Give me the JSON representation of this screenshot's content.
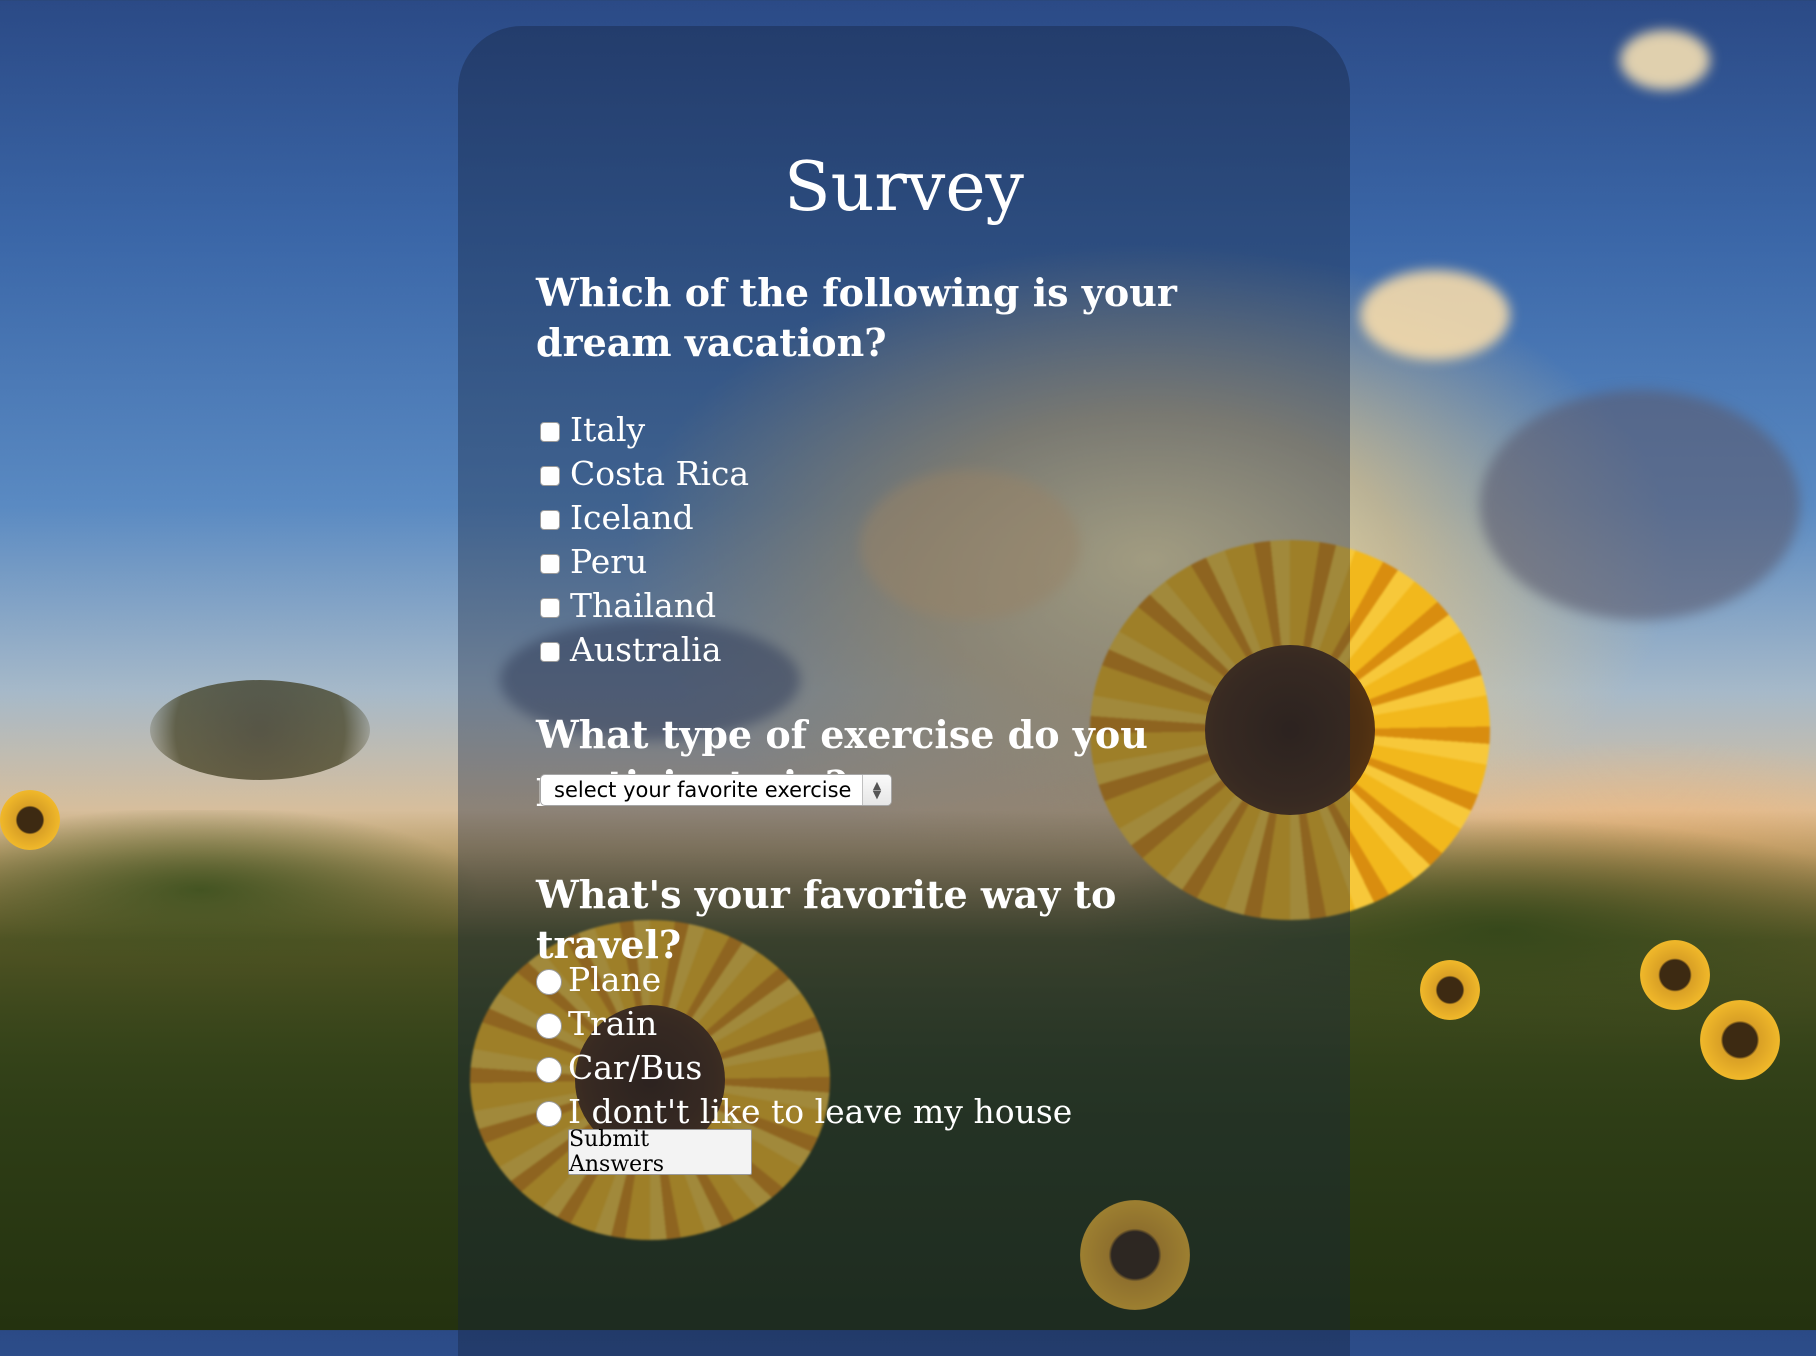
{
  "survey": {
    "title": "Survey",
    "q1": {
      "text": "Which of the following is your dream vacation?",
      "options": [
        "Italy",
        "Costa Rica",
        "Iceland",
        "Peru",
        "Thailand",
        "Australia"
      ]
    },
    "q2": {
      "text": "What type of exercise do you participate in?",
      "select_value": "select your favorite exercise"
    },
    "q3": {
      "text": "What's your favorite way to travel?",
      "options": [
        "Plane",
        "Train",
        "Car/Bus",
        "I dont't like to leave my house"
      ]
    },
    "submit_label": "Submit Answers"
  },
  "colors": {
    "panel_overlay": "#14233c",
    "text": "#ffffff",
    "sky_top": "#2b4a86",
    "sunflower": "#f2b81c"
  },
  "icons": {
    "checkbox": "checkbox-icon",
    "radio": "radio-icon",
    "select_arrows": "chevron-updown-icon"
  }
}
